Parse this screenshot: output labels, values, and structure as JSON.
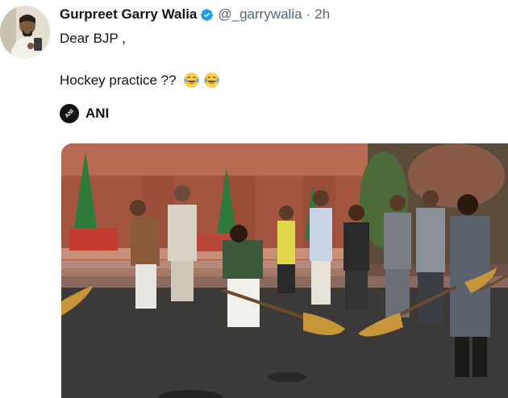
{
  "tweet": {
    "display_name": "Gurpreet Garry Walia",
    "handle": "@_garrywalia",
    "separator": "·",
    "time": "2h",
    "verified": true,
    "text_line1": "Dear BJP ,",
    "text_line2": "Hockey practice ??",
    "emojis": [
      "face-with-tears-of-joy-icon",
      "face-with-tears-of-joy-icon"
    ]
  },
  "quoted": {
    "account_name": "ANI",
    "logo_text": "ANI"
  },
  "colors": {
    "verified_blue": "#1d9bf0",
    "secondary_text": "#536471",
    "primary_text": "#0f1419"
  }
}
